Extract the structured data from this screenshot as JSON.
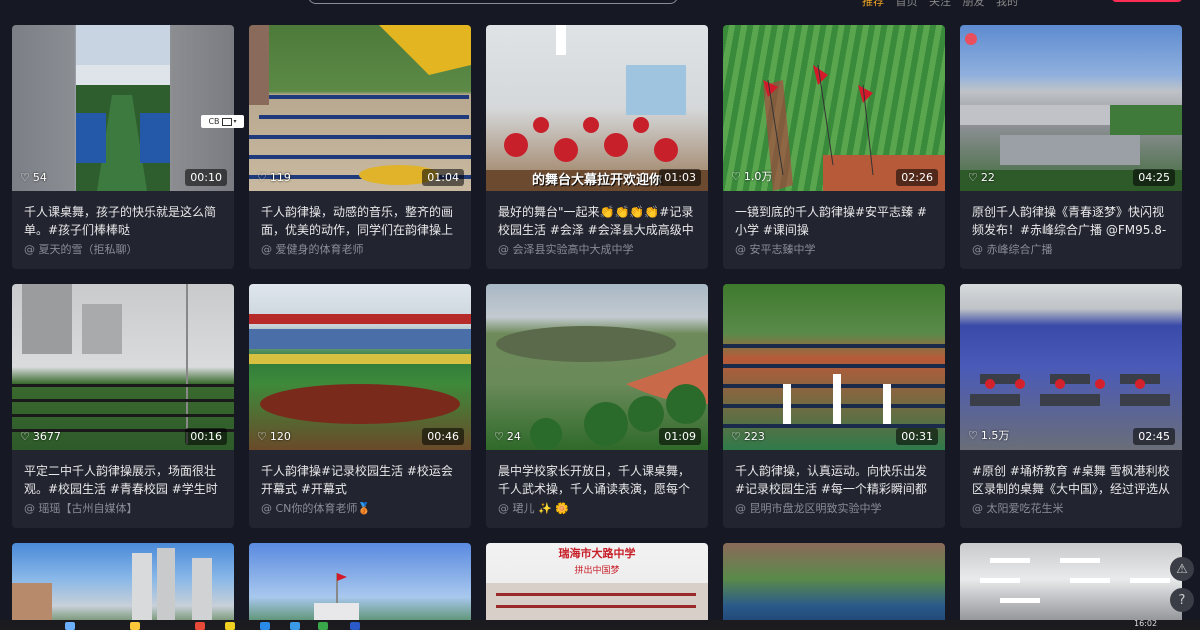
{
  "header": {
    "nav": [
      "推荐",
      "首页",
      "关注",
      "朋友",
      "我的"
    ],
    "active_nav": "推荐"
  },
  "colors": {
    "accent": "#fe2c55",
    "active_nav": "#f5a623",
    "background": "#161823",
    "card": "#22242f"
  },
  "cb_badge": "CB",
  "videos": [
    {
      "likes": "54",
      "duration": "00:10",
      "title": "千人课桌舞，孩子的快乐就是这么简单。#孩子们棒棒哒",
      "author": "@ 夏天的雪（拒私聊）"
    },
    {
      "likes": "119",
      "duration": "01:04",
      "title": "千人韵律操，动感的音乐，整齐的画面，优美的动作，同学们在韵律操上尽情地…",
      "author": "@ 爱健身的体育老师"
    },
    {
      "likes": "",
      "duration": "01:03",
      "title": "最好的舞台\"一起来👏👏👏👏#记录校园生活 #会泽 #会泽县大成高级中学 #大…",
      "author": "@ 会泽县实验高中大成中学"
    },
    {
      "likes": "1.0万",
      "duration": "02:26",
      "title": "一镜到底的千人韵律操#安平志臻 #小学 #课间操",
      "author": "@ 安平志臻中学"
    },
    {
      "likes": "22",
      "duration": "04:25",
      "title": "原创千人韵律操《青春逐梦》快闪视频发布！#赤峰综合广播 @FM95.8-贾落",
      "author": "@ 赤峰综合广播"
    },
    {
      "likes": "3677",
      "duration": "00:16",
      "title": "平定二中千人韵律操展示，场面很壮观。#校园生活 #青春校园 #学生时代",
      "author": "@ 瑶瑶【古州自媒体】"
    },
    {
      "likes": "120",
      "duration": "00:46",
      "title": "千人韵律操#记录校园生活 #校运会开幕式 #开幕式",
      "author": "@ CN你的体育老师🥉"
    },
    {
      "likes": "24",
      "duration": "01:09",
      "title": "晨中学校家长开放日，千人课桌舞，千人武术操，千人诵读表演，愿每个孩子都…",
      "author": "@ 珺儿 ✨ 🌼"
    },
    {
      "likes": "223",
      "duration": "00:31",
      "title": "千人韵律操，认真运动。向快乐出发#记录校园生活 #每一个精彩瞬间都值得记录 …",
      "author": "@ 昆明市盘龙区明致实验中学"
    },
    {
      "likes": "1.5万",
      "duration": "02:45",
      "title": "#原创 #埇桥教育 #桌舞 雪枫港利校区录制的桌舞《大中国》，经过评选从一百…",
      "author": "@ 太阳爱吃花生米"
    },
    {
      "likes": "",
      "duration": "",
      "title": "",
      "author": ""
    },
    {
      "likes": "",
      "duration": "",
      "title": "",
      "author": ""
    },
    {
      "likes": "",
      "duration": "",
      "title": "",
      "author": ""
    },
    {
      "likes": "",
      "duration": "",
      "title": "",
      "author": ""
    },
    {
      "likes": "",
      "duration": "",
      "title": "",
      "author": ""
    }
  ],
  "thumb_overlays": {
    "v3": "的舞台大幕拉开欢迎你",
    "v13": "瑞海市大路中学",
    "v13b": "拼出中国梦"
  },
  "taskbar": {
    "time": "16:02"
  }
}
